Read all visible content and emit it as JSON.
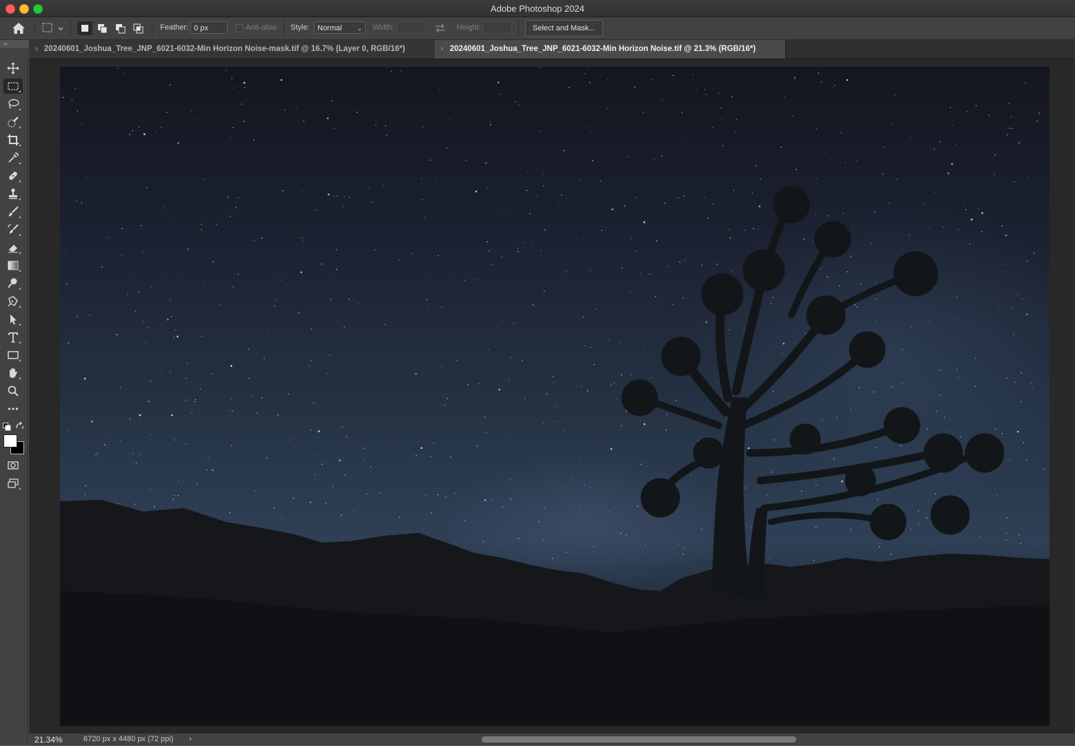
{
  "window": {
    "title": "Adobe Photoshop 2024"
  },
  "options_bar": {
    "feather_label": "Feather:",
    "feather_value": "0 px",
    "anti_alias_label": "Anti-alias",
    "style_label": "Style:",
    "style_value": "Normal",
    "width_label": "Width:",
    "height_label": "Height:",
    "select_mask_label": "Select and Mask..."
  },
  "tabs": [
    {
      "label": "20240601_Joshua_Tree_JNP_6021-6032-Min Horizon Noise-mask.tif @ 16.7% (Layer 0, RGB/16*)",
      "active": false
    },
    {
      "label": "20240601_Joshua_Tree_JNP_6021-6032-Min Horizon Noise.tif @ 21.3% (RGB/16*)",
      "active": true
    }
  ],
  "tools": [
    "move-tool-icon",
    "rectangular-marquee-tool-icon",
    "lasso-tool-icon",
    "quick-selection-tool-icon",
    "crop-tool-icon",
    "eyedropper-tool-icon",
    "spot-healing-brush-icon",
    "clone-stamp-icon",
    "brush-tool-icon",
    "history-brush-icon",
    "eraser-tool-icon",
    "gradient-tool-icon",
    "dodge-tool-icon",
    "pen-tool-icon",
    "path-selection-icon",
    "type-tool-icon",
    "rectangle-tool-icon",
    "hand-tool-icon",
    "zoom-tool-icon",
    "edit-toolbar-icon"
  ],
  "status_bar": {
    "zoom": "21.34%",
    "doc_info": "6720 px x 4480 px (72 ppi)",
    "arrow": "›"
  },
  "colors": {
    "foreground": "#ffffff",
    "background": "#000000"
  }
}
